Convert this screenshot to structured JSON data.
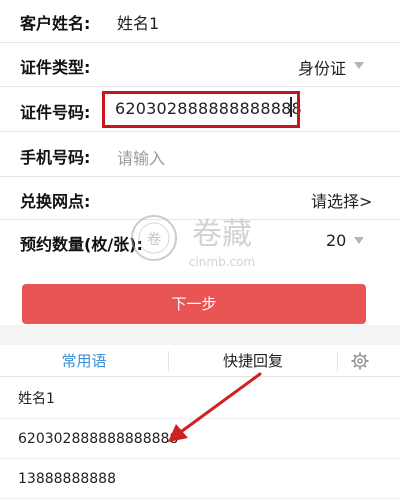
{
  "form": {
    "customer_name": {
      "label": "客户姓名:",
      "value": "姓名1"
    },
    "id_type": {
      "label": "证件类型:",
      "value": "身份证"
    },
    "id_number": {
      "label": "证件号码:",
      "value": "620302888888888888"
    },
    "phone": {
      "label": "手机号码:",
      "placeholder": "请输入"
    },
    "exchange_outlet": {
      "label": "兑换网点:",
      "value": "请选择>"
    },
    "quantity": {
      "label": "预约数量(枚/张):",
      "value": "20"
    }
  },
  "next_button": {
    "label": "下一步"
  },
  "tabs": {
    "common_phrases": "常用语",
    "quick_reply": "快捷回复"
  },
  "quick_list": [
    "姓名1",
    "620302888888888888",
    "13888888888"
  ],
  "watermark": {
    "text": "卷藏",
    "domain": "cinmb.com"
  },
  "colors": {
    "accent": "#e95454",
    "highlight": "#c4161c",
    "tab_active": "#3a8fd6"
  }
}
